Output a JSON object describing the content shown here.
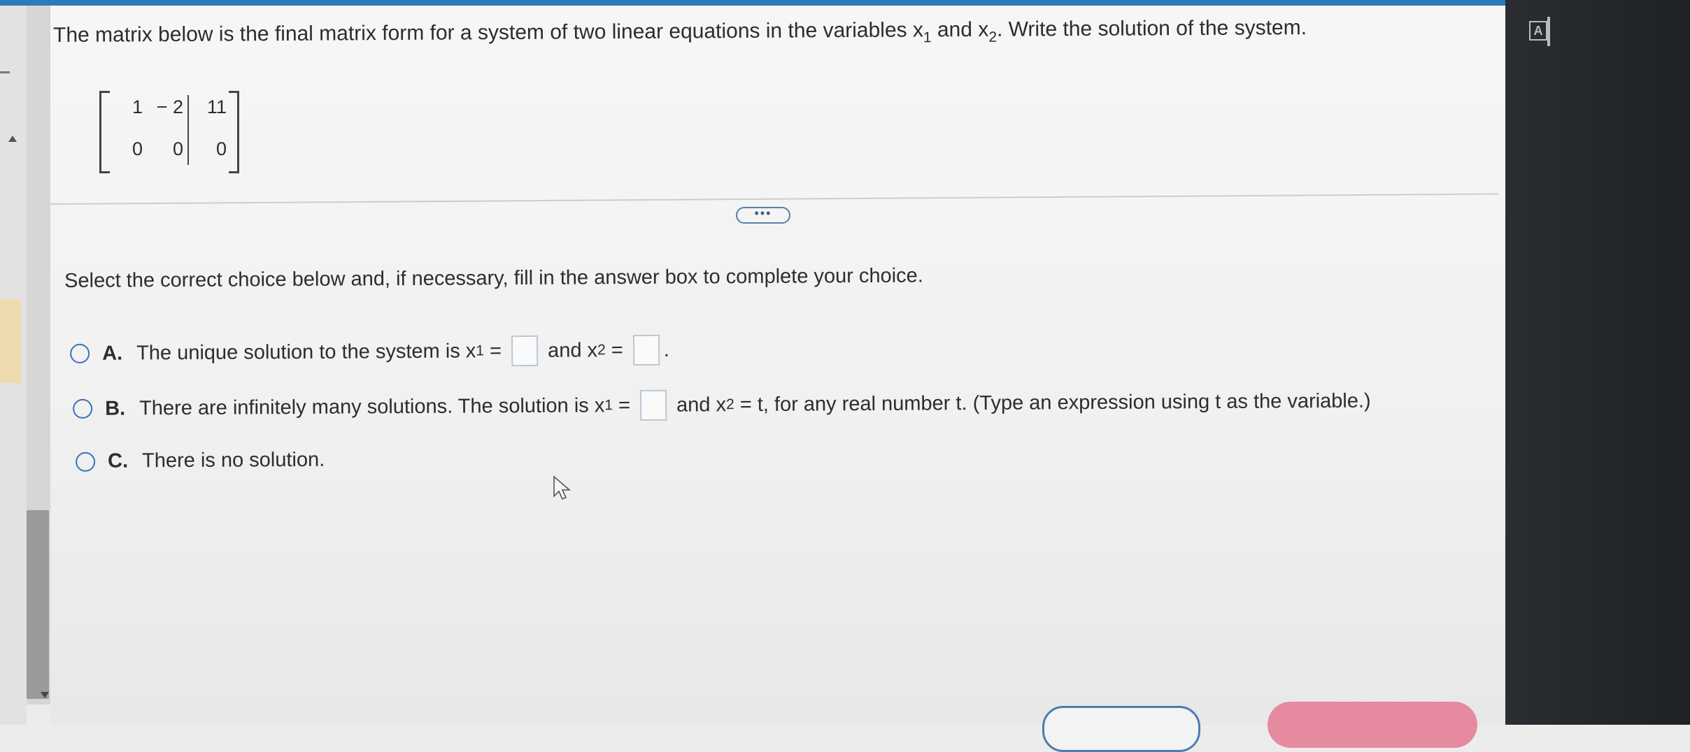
{
  "question": {
    "part1": "The matrix below is the final matrix form for a system of two linear equations in the variables x",
    "sub1": "1",
    "part2": " and x",
    "sub2": "2",
    "part3": ". Write the solution of the system."
  },
  "matrix": {
    "rows": [
      [
        "1",
        "− 2",
        "11"
      ],
      [
        "0",
        "0",
        "0"
      ]
    ]
  },
  "more_button": "•••",
  "instruction": "Select the correct choice below and, if necessary, fill in the answer box to complete your choice.",
  "choices": {
    "a": {
      "letter": "A.",
      "text1": "The unique solution to the system is x",
      "sub1": "1",
      "text2": " = ",
      "text3": " and x",
      "sub2": "2",
      "text4": " = ",
      "text5": "."
    },
    "b": {
      "letter": "B.",
      "text1": "There are infinitely many solutions. The solution is x",
      "sub1": "1",
      "text2": " = ",
      "text3": " and x",
      "sub2": "2",
      "text4": " = t, for any real number t. (Type an expression using t as the variable.)"
    },
    "c": {
      "letter": "C.",
      "text1": "There is no solution."
    }
  },
  "icons": {
    "accessibility": "A",
    "radio_color": "#3a72b8"
  },
  "colors": {
    "top_bar": "#2d7bb8",
    "check_answer_button": "#e68aa0"
  }
}
